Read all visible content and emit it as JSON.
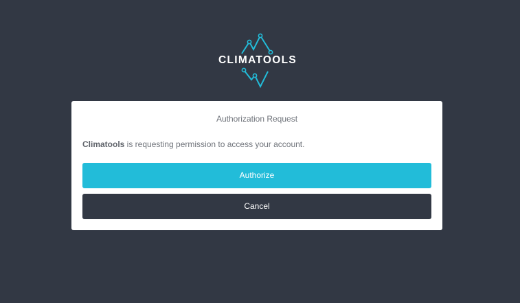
{
  "brand": {
    "name": "CLIMATOOLS",
    "accent_color": "#22bcd9",
    "background_color": "#323844"
  },
  "dialog": {
    "title": "Authorization Request",
    "app_name": "Climatools",
    "message_suffix": " is requesting permission to access your account."
  },
  "buttons": {
    "authorize_label": "Authorize",
    "cancel_label": "Cancel"
  }
}
